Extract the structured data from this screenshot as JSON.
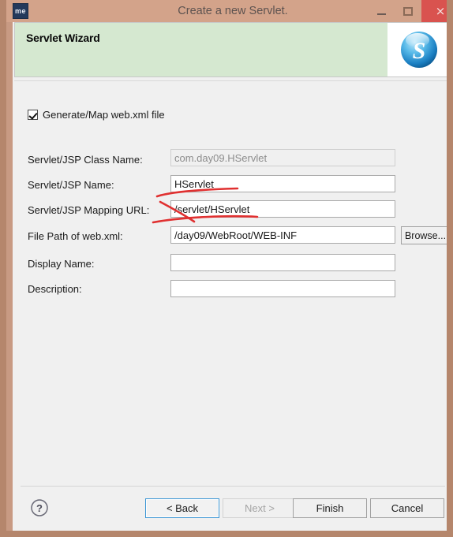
{
  "window": {
    "title": "Create a new Servlet.",
    "app_icon_label": "me",
    "icon_minimize": "minimize-icon",
    "icon_maximize": "maximize-icon",
    "icon_close": "close-icon",
    "close_glyph": "×",
    "frame_color": "#b5866c",
    "titlebar_color": "#d3a38a",
    "close_button_color": "#d9534f"
  },
  "banner": {
    "title": "Servlet Wizard",
    "logo_letter": "S",
    "logo_name": "servlet-sphere-logo",
    "background_color": "#d5e8d0"
  },
  "options": {
    "generate_webxml_label": "Generate/Map web.xml file",
    "generate_webxml_checked": true
  },
  "form": {
    "fields": [
      {
        "name": "servlet-class-name",
        "label": "Servlet/JSP Class Name:",
        "value": "com.day09.HServlet",
        "placeholder": "",
        "disabled": true
      },
      {
        "name": "servlet-name",
        "label": "Servlet/JSP Name:",
        "value": "HServlet",
        "placeholder": "",
        "disabled": false
      },
      {
        "name": "servlet-mapping-url",
        "label": "Servlet/JSP Mapping URL:",
        "value": "/servlet/HServlet",
        "placeholder": "",
        "disabled": false
      },
      {
        "name": "webxml-file-path",
        "label": "File Path of web.xml:",
        "value": "/day09/WebRoot/WEB-INF",
        "placeholder": "",
        "disabled": false
      },
      {
        "name": "display-name",
        "label": "Display Name:",
        "value": "",
        "placeholder": "",
        "disabled": false
      },
      {
        "name": "description",
        "label": "Description:",
        "value": "",
        "placeholder": "",
        "disabled": false
      }
    ],
    "browse_label": "Browse..."
  },
  "annotations": {
    "color": "#e03030",
    "marks": [
      "underline-under-servlet-name",
      "slash-through-mapping-url",
      "underline-under-mapping-url"
    ]
  },
  "footer": {
    "help_glyph": "?",
    "buttons": [
      {
        "name": "back-button",
        "label": "< Back",
        "disabled": false,
        "focused": true
      },
      {
        "name": "next-button",
        "label": "Next >",
        "disabled": true,
        "focused": false
      },
      {
        "name": "finish-button",
        "label": "Finish",
        "disabled": false,
        "focused": false
      },
      {
        "name": "cancel-button",
        "label": "Cancel",
        "disabled": false,
        "focused": false
      }
    ]
  }
}
